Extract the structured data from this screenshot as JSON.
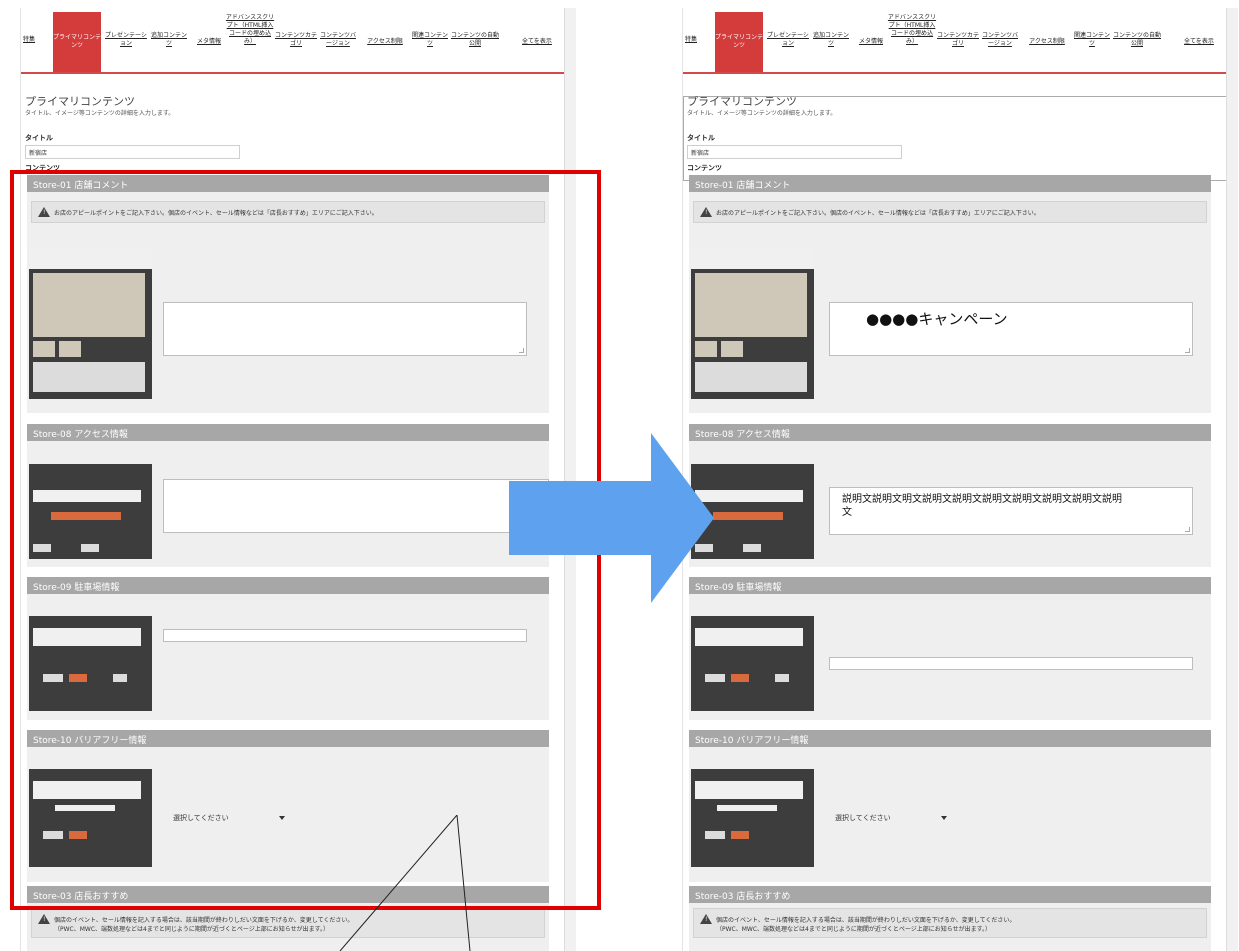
{
  "tabs": [
    {
      "label": "特集"
    },
    {
      "label": "プライマリコンテンツ",
      "active": true
    },
    {
      "label": "プレゼンテーション"
    },
    {
      "label": "追加コンテンツ"
    },
    {
      "label": "メタ情報"
    },
    {
      "label": "アドバンススクリプト（HTML挿入コードの埋め込み）"
    },
    {
      "label": "コンテンツカテゴリ"
    },
    {
      "label": "コンテンツバージョン"
    },
    {
      "label": "アクセス制限"
    },
    {
      "label": "関連コンテンツ"
    },
    {
      "label": "コンテンツの自動公開"
    },
    {
      "label": "全てを表示",
      "show_all": true
    }
  ],
  "header": {
    "title": "プライマリコンテンツ",
    "subtitle": "タイトル、イメージ等コンテンツの詳細を入力します。",
    "title_label": "タイトル",
    "title_value": "新宿店",
    "content_label": "コンテンツ"
  },
  "sections": {
    "store01": {
      "title": "Store-01 店舗コメント",
      "notice": "お店のアピールポイントをご記入下さい。個店のイベント、セール情報などは「店長おすすめ」エリアにご記入下さい。"
    },
    "store08": {
      "title": "Store-08 アクセス情報"
    },
    "store09": {
      "title": "Store-09 駐車場情報"
    },
    "store10": {
      "title": "Store-10 バリアフリー情報",
      "select_placeholder": "選択してください"
    },
    "store03": {
      "title": "Store-03 店長おすすめ",
      "notice_line1": "個店のイベント、セール情報を記入する場合は、該当期間が終わりしだい文面を下げるか、変更してください。",
      "notice_line2": "（PWC、MWC、端数処理などは4までと同じように期間が近づくとページ上部にお知らせが出ます。）"
    }
  },
  "filled": {
    "store01_value": "●●●●キャンペーン",
    "store08_value": "説明文説明文明文説明文説明文説明文説明文説明文説明文説明文"
  },
  "colors": {
    "accent": "#d43b3b",
    "highlight": "#e10000",
    "arrow": "#5ea2ef",
    "section_bar": "#a7a7a7"
  }
}
